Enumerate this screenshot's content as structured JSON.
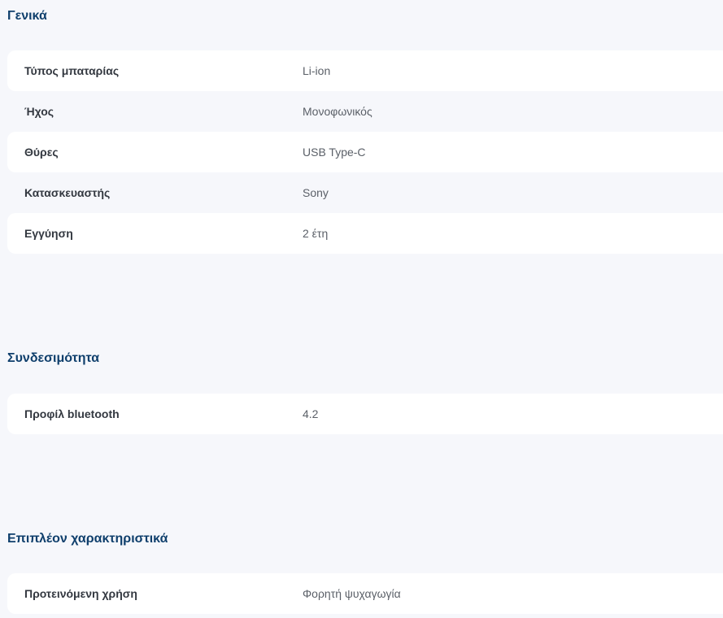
{
  "sections": [
    {
      "title": "Γενικά",
      "rows": [
        {
          "label": "Τύπος μπαταρίας",
          "value": "Li-ion"
        },
        {
          "label": "Ήχος",
          "value": "Μονοφωνικός"
        },
        {
          "label": "Θύρες",
          "value": "USB Type-C"
        },
        {
          "label": "Κατασκευαστής",
          "value": "Sony"
        },
        {
          "label": "Εγγύηση",
          "value": "2 έτη"
        }
      ]
    },
    {
      "title": "Συνδεσιμότητα",
      "rows": [
        {
          "label": "Προφίλ bluetooth",
          "value": "4.2"
        }
      ]
    },
    {
      "title": "Επιπλέον χαρακτηριστικά",
      "rows": [
        {
          "label": "Προτεινόμενη χρήση",
          "value": "Φορητή ψυχαγωγία"
        }
      ]
    }
  ]
}
